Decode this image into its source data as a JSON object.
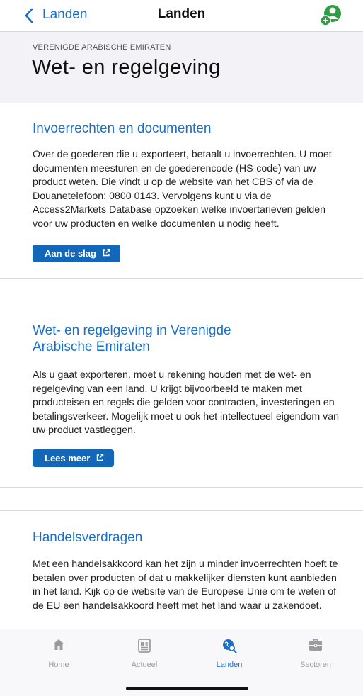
{
  "nav": {
    "back_label": "Landen",
    "title": "Landen"
  },
  "header": {
    "eyebrow": "VERENIGDE ARABISCHE EMIRATEN",
    "title": "Wet- en regelgeving"
  },
  "sections": [
    {
      "title": "Invoerrechten en documenten",
      "body": "Over de goederen die u exporteert, betaalt u invoerrechten. U moet documenten meesturen en de goederencode (HS-code) van uw product weten. Die vindt u op de website van het CBS of via de Douanetelefoon: 0800 0143. Vervolgens kunt u via de Access2Markets Database opzoeken welke invoertarieven gelden voor uw producten en welke documenten u nodig heeft.",
      "button": "Aan de slag"
    },
    {
      "title": "Wet- en regelgeving in Verenigde Arabische Emiraten",
      "body": "Als u gaat exporteren, moet u rekening houden met de wet- en regelgeving van een land. U krijgt bijvoorbeeld te maken met producteisen en regels die gelden voor contracten, investeringen en betalingsverkeer. Mogelijk moet u ook het intellectueel eigendom van uw product vastleggen.",
      "button": "Lees meer"
    },
    {
      "title": "Handelsverdragen",
      "body": "Met een handelsakkoord kan het zijn u minder invoerrechten hoeft te betalen over producten of dat u makkelijker diensten kunt aanbieden in het land. Kijk op de website van de Europese Unie om te weten of de EU een handelsakkoord heeft met het land waar u zakendoet."
    }
  ],
  "tabs": [
    {
      "label": "Home",
      "icon": "home-icon"
    },
    {
      "label": "Actueel",
      "icon": "newspaper-icon"
    },
    {
      "label": "Landen",
      "icon": "globe-search-icon"
    },
    {
      "label": "Sectoren",
      "icon": "briefcase-icon"
    }
  ],
  "colors": {
    "accent": "#1b6fc7",
    "button": "#1367b8",
    "profile_icon": "#2e9e45",
    "header_bg": "#f3f3f7"
  }
}
